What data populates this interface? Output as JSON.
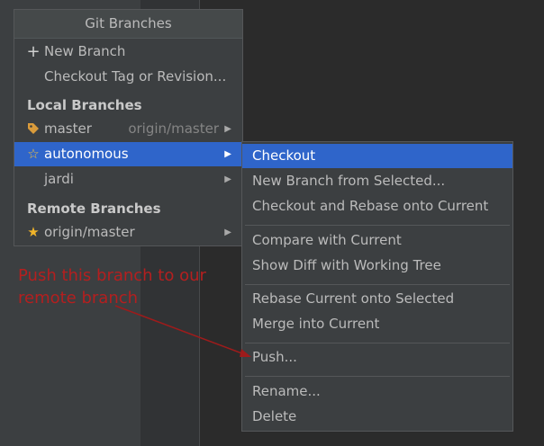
{
  "popup": {
    "title": "Git Branches",
    "new_branch": "New Branch",
    "checkout_tag": "Checkout Tag or Revision...",
    "local_header": "Local Branches",
    "local": [
      {
        "name": "master",
        "tracking": "origin/master",
        "icon": "tag-icon"
      },
      {
        "name": "autonomous",
        "icon": "star-outline-icon",
        "selected": true
      },
      {
        "name": "jardi"
      }
    ],
    "remote_header": "Remote Branches",
    "remote": [
      {
        "name": "origin/master",
        "icon": "star-icon"
      }
    ]
  },
  "submenu": {
    "items": [
      "Checkout",
      "New Branch from Selected...",
      "Checkout and Rebase onto Current",
      "Compare with Current",
      "Show Diff with Working Tree",
      "Rebase Current onto Selected",
      "Merge into Current",
      "Push...",
      "Rename...",
      "Delete"
    ]
  },
  "annotation": {
    "text": "Push this branch to our remote branch",
    "color": "#b41f1f"
  },
  "colors": {
    "selection": "#2f65ca",
    "popup_bg": "#3c3f41",
    "editor_bg": "#2b2b2b"
  }
}
